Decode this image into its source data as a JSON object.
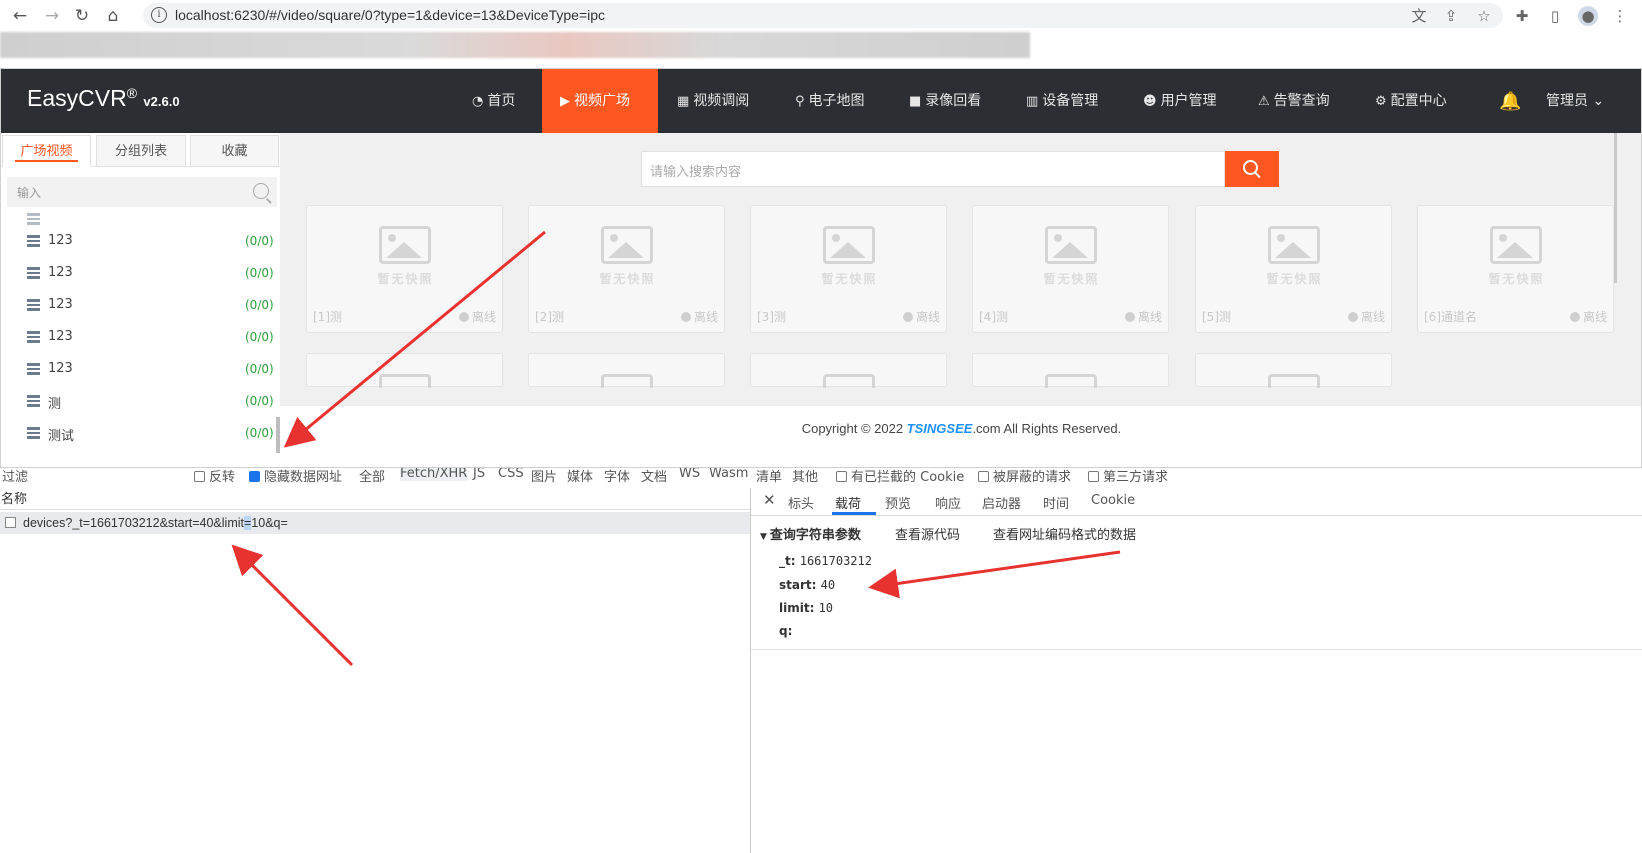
{
  "browser": {
    "url": "localhost:6230/#/video/square/0?type=1&device=13&DeviceType=ipc",
    "icons": [
      "back-icon",
      "forward-icon",
      "reload-icon",
      "home-icon",
      "info-icon",
      "translate-icon",
      "share-icon",
      "star-icon",
      "extensions-icon",
      "sidepanel-icon",
      "profile-icon",
      "more-icon"
    ]
  },
  "app": {
    "brand": "EasyCVR",
    "brand_reg": "®",
    "version": "v2.6.0",
    "nav": [
      {
        "label": "首页",
        "icon": "dashboard-icon"
      },
      {
        "label": "视频广场",
        "icon": "play-icon"
      },
      {
        "label": "视频调阅",
        "icon": "grid-icon"
      },
      {
        "label": "电子地图",
        "icon": "map-pin-icon"
      },
      {
        "label": "录像回看",
        "icon": "video-camera-icon"
      },
      {
        "label": "设备管理",
        "icon": "devices-icon"
      },
      {
        "label": "用户管理",
        "icon": "user-icon"
      },
      {
        "label": "告警查询",
        "icon": "alarm-icon"
      },
      {
        "label": "配置中心",
        "icon": "gear-icon"
      }
    ],
    "admin_label": "管理员",
    "accent": "#ff5722",
    "sidebar": {
      "tabs": [
        "广场视频",
        "分组列表",
        "收藏"
      ],
      "search_placeholder": "输入",
      "devices": [
        {
          "name": "123",
          "count": "(0/0)"
        },
        {
          "name": "123",
          "count": "(0/0)"
        },
        {
          "name": "123",
          "count": "(0/0)"
        },
        {
          "name": "123",
          "count": "(0/0)"
        },
        {
          "name": "123",
          "count": "(0/0)"
        },
        {
          "name": "测",
          "count": "(0/0)"
        },
        {
          "name": "测试",
          "count": "(0/0)"
        }
      ]
    },
    "main": {
      "search_placeholder": "请输入搜索内容",
      "no_snapshot": "暂无快照",
      "status": "离线",
      "cards": [
        "[1]测",
        "[2]测",
        "[3]测",
        "[4]测",
        "[5]测",
        "[6]通道名"
      ],
      "copyright_prefix": "Copyright © 2022 ",
      "copyright_brand": "TSINGSEE",
      "copyright_suffix": ".com All Rights Reserved."
    }
  },
  "devtools": {
    "filter": {
      "label": "过滤",
      "invert": "反转",
      "hide_data_urls": "隐藏数据网址",
      "types": [
        "全部",
        "Fetch/XHR",
        "JS",
        "CSS",
        "图片",
        "媒体",
        "字体",
        "文档",
        "WS",
        "Wasm",
        "清单",
        "其他"
      ],
      "blocked_cookies": "有已拦截的 Cookie",
      "blocked_requests": "被屏蔽的请求",
      "third_party": "第三方请求"
    },
    "name_header": "名称",
    "request": {
      "before": "devices?_t=1661703212&start=40&limit",
      "highlight": "=",
      "after": "10&q="
    },
    "detail_tabs": [
      "标头",
      "载荷",
      "预览",
      "响应",
      "启动器",
      "时间",
      "Cookie"
    ],
    "payload": {
      "section": "查询字符串参数",
      "view_source": "查看源代码",
      "view_url_encoded": "查看网址编码格式的数据",
      "params": [
        {
          "key": "_t",
          "value": "1661703212"
        },
        {
          "key": "start",
          "value": "40"
        },
        {
          "key": "limit",
          "value": "10"
        },
        {
          "key": "q",
          "value": ""
        }
      ]
    }
  }
}
